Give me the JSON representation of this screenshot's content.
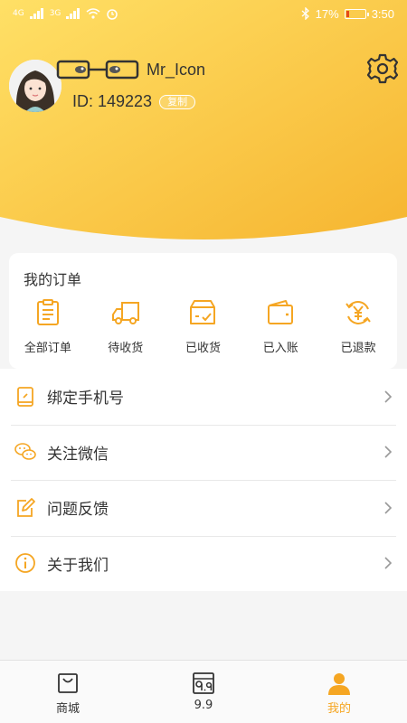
{
  "status_bar": {
    "network_left": "4G",
    "network_right": "3G",
    "battery": "17%",
    "battery_level": 0.17,
    "time": "3:50"
  },
  "profile": {
    "username": "Mr_Icon",
    "user_id": "ID: 149223",
    "copy_label": "复制"
  },
  "orders": {
    "title": "我的订单",
    "items": [
      {
        "label": "全部订单",
        "icon": "clipboard-icon"
      },
      {
        "label": "待收货",
        "icon": "truck-icon"
      },
      {
        "label": "已收货",
        "icon": "box-check-icon"
      },
      {
        "label": "已入账",
        "icon": "wallet-icon"
      },
      {
        "label": "已退款",
        "icon": "yuan-refund-icon"
      }
    ]
  },
  "menu": {
    "items": [
      {
        "label": "绑定手机号",
        "icon": "phone-icon"
      },
      {
        "label": "关注微信",
        "icon": "wechat-icon"
      },
      {
        "label": "问题反馈",
        "icon": "edit-icon"
      },
      {
        "label": "关于我们",
        "icon": "info-icon"
      }
    ]
  },
  "bottom_nav": {
    "items": [
      {
        "label": "商城",
        "icon": "shopping-bag-icon",
        "active": false
      },
      {
        "label": "9.9",
        "icon": "nine-nine-icon",
        "active": false
      },
      {
        "label": "我的",
        "icon": "person-icon",
        "active": true
      }
    ]
  },
  "colors": {
    "accent": "#f5a623",
    "header_gradient_start": "#ffe066",
    "header_gradient_end": "#f7b731"
  }
}
